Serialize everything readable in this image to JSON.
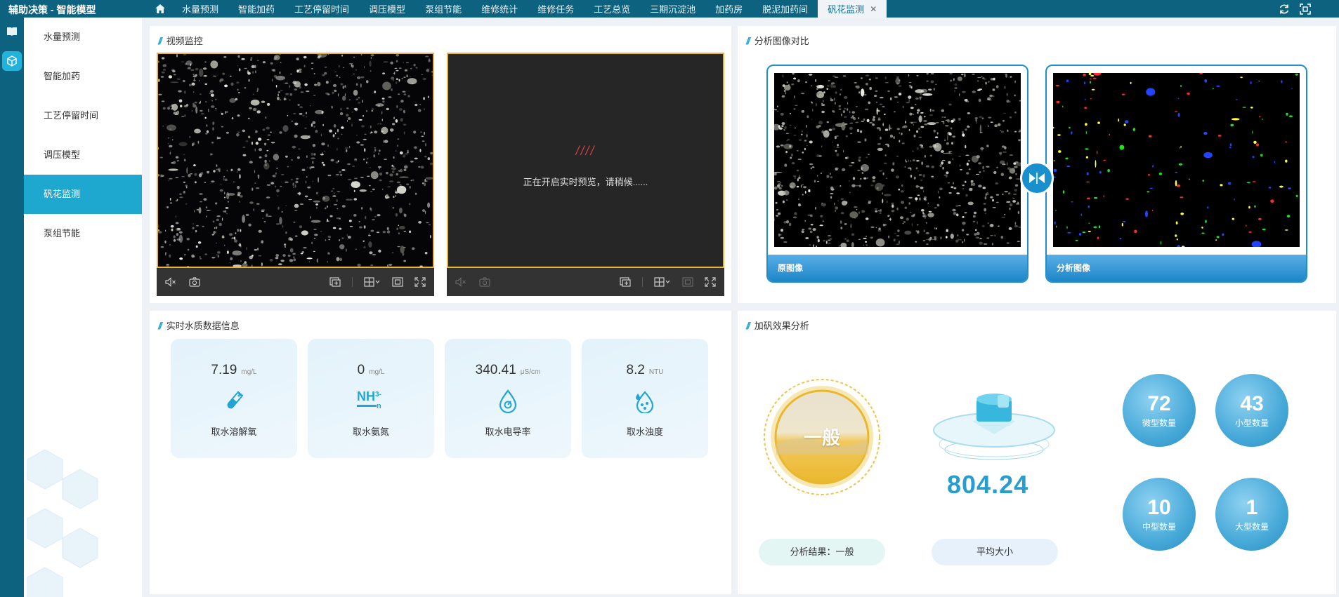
{
  "app": {
    "title": "辅助决策 - 智能模型"
  },
  "tabs": [
    {
      "label": "水量预测"
    },
    {
      "label": "智能加药"
    },
    {
      "label": "工艺停留时间"
    },
    {
      "label": "调压模型"
    },
    {
      "label": "泵组节能"
    },
    {
      "label": "维修统计"
    },
    {
      "label": "维修任务"
    },
    {
      "label": "工艺总览"
    },
    {
      "label": "三期沉淀池"
    },
    {
      "label": "加药房"
    },
    {
      "label": "脱泥加药间"
    },
    {
      "label": "矾花监测",
      "active": true
    }
  ],
  "sidebar": {
    "items": [
      {
        "label": "水量预测"
      },
      {
        "label": "智能加药"
      },
      {
        "label": "工艺停留时间"
      },
      {
        "label": "调压模型"
      },
      {
        "label": "矾花监测",
        "active": true
      },
      {
        "label": "泵组节能"
      }
    ]
  },
  "video_panel": {
    "title": "视频监控",
    "loading_text": "正在开启实时预览，请稍候......",
    "loading_bars": "////"
  },
  "compare_panel": {
    "title": "分析图像对比",
    "original_label": "原图像",
    "analysis_label": "分析图像"
  },
  "water_panel": {
    "title": "实时水质数据信息",
    "cards": [
      {
        "value": "7.19",
        "unit": "mg/L",
        "label": "取水溶解氧",
        "icon": "test-tube-icon"
      },
      {
        "value": "0",
        "unit": "mg/L",
        "label": "取水氨氮",
        "icon": "ammonia-icon",
        "icon_text": "NH",
        "icon_sup": "3-",
        "icon_sub": "n"
      },
      {
        "value": "340.41",
        "unit": "μS/cm",
        "label": "取水电导率",
        "icon": "conductivity-drop-icon"
      },
      {
        "value": "8.2",
        "unit": "NTU",
        "label": "取水浊度",
        "icon": "turbidity-drop-icon"
      }
    ]
  },
  "effect_panel": {
    "title": "加矾效果分析",
    "level": "一般",
    "result_label": "分析结果：一般",
    "avg_size_value": "804.24",
    "avg_size_label": "平均大小",
    "counts": [
      {
        "value": "72",
        "label": "微型数量"
      },
      {
        "value": "43",
        "label": "小型数量"
      },
      {
        "value": "10",
        "label": "中型数量"
      },
      {
        "value": "1",
        "label": "大型数量"
      }
    ]
  },
  "colors": {
    "nav": "#0d6280",
    "accent": "#1ea8cf",
    "frame": "#e8b43b",
    "result_pill": "#e4f6f4",
    "avg_pill": "#e6f1fb"
  }
}
